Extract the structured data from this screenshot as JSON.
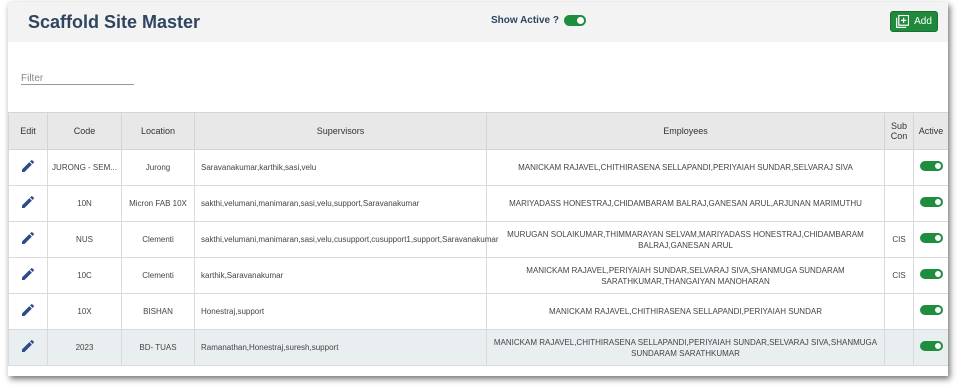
{
  "header": {
    "title": "Scaffold Site Master",
    "show_active_label": "Show Active ?",
    "add_label": "Add"
  },
  "filter": {
    "placeholder": "Filter"
  },
  "columns": [
    "Edit",
    "Code",
    "Location",
    "Supervisors",
    "Employees",
    "Sub Con",
    "Active"
  ],
  "rows": [
    {
      "code": "JURONG - SEM...",
      "location": "Jurong",
      "supervisors": "Saravanakumar,karthik,sasi,velu",
      "employees": "MANICKAM RAJAVEL,CHITHIRASENA SELLAPANDI,PERIYAIAH SUNDAR,SELVARAJ SIVA",
      "subcon": "",
      "active": true
    },
    {
      "code": "10N",
      "location": "Micron FAB 10X",
      "supervisors": "sakthi,velumani,manimaran,sasi,velu,support,Saravanakumar",
      "employees": "MARIYADASS HONESTRAJ,CHIDAMBARAM BALRAJ,GANESAN ARUL,ARJUNAN MARIMUTHU",
      "subcon": "",
      "active": true
    },
    {
      "code": "NUS",
      "location": "Clementi",
      "supervisors": "sakthi,velumani,manimaran,sasi,velu,cusupport,cusupport1,support,Saravanakumar",
      "employees": "MURUGAN SOLAIKUMAR,THIMMARAYAN SELVAM,MARIYADASS HONESTRAJ,CHIDAMBARAM BALRAJ,GANESAN ARUL",
      "subcon": "CIS",
      "active": true
    },
    {
      "code": "10C",
      "location": "Clementi",
      "supervisors": "karthik,Saravanakumar",
      "employees": "MANICKAM RAJAVEL,PERIYAIAH SUNDAR,SELVARAJ SIVA,SHANMUGA SUNDARAM SARATHKUMAR,THANGAIYAN MANOHARAN",
      "subcon": "CIS",
      "active": true
    },
    {
      "code": "10X",
      "location": "BISHAN",
      "supervisors": "Honestraj,support",
      "employees": "MANICKAM RAJAVEL,CHITHIRASENA SELLAPANDI,PERIYAIAH SUNDAR",
      "subcon": "",
      "active": true
    },
    {
      "code": "2023",
      "location": "BD- TUAS",
      "supervisors": "Ramanathan,Honestraj,suresh,support",
      "employees": "MANICKAM RAJAVEL,CHITHIRASENA SELLAPANDI,PERIYAIAH SUNDAR,SELVARAJ SIVA,SHANMUGA SUNDARAM SARATHKUMAR",
      "subcon": "",
      "active": true
    }
  ]
}
